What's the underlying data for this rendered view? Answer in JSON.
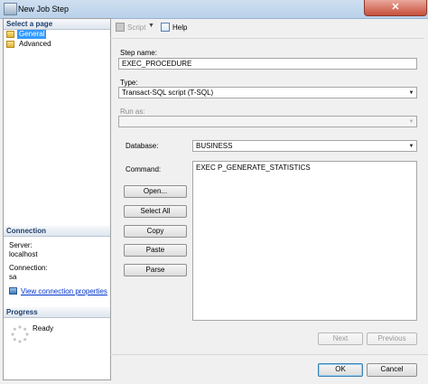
{
  "window": {
    "title": "New Job Step",
    "close_glyph": "✕"
  },
  "left_panel": {
    "select_page_header": "Select a page",
    "pages": [
      {
        "label": "General",
        "icon": "page-icon",
        "selected": true
      },
      {
        "label": "Advanced",
        "icon": "page-icon",
        "selected": false
      }
    ],
    "connection_header": "Connection",
    "server_label": "Server:",
    "server_value": "localhost",
    "connection_label": "Connection:",
    "connection_value": "sa",
    "view_connection_link": "View connection properties",
    "progress_header": "Progress",
    "progress_status": "Ready"
  },
  "toolbar": {
    "script_label": "Script",
    "help_label": "Help"
  },
  "form": {
    "step_name_label": "Step name:",
    "step_name_value": "EXEC_PROCEDURE",
    "type_label": "Type:",
    "type_value": "Transact-SQL script (T-SQL)",
    "run_as_label": "Run as:",
    "run_as_value": "",
    "database_label": "Database:",
    "database_value": "BUSINESS",
    "command_label": "Command:",
    "command_value": "EXEC P_GENERATE_STATISTICS",
    "buttons": {
      "open": "Open...",
      "select_all": "Select All",
      "copy": "Copy",
      "paste": "Paste",
      "parse": "Parse"
    },
    "next": "Next",
    "previous": "Previous"
  },
  "dialog": {
    "ok": "OK",
    "cancel": "Cancel"
  },
  "colors": {
    "selection": "#3399ff",
    "link": "#0033cc",
    "header_text": "#1e3f6b"
  }
}
